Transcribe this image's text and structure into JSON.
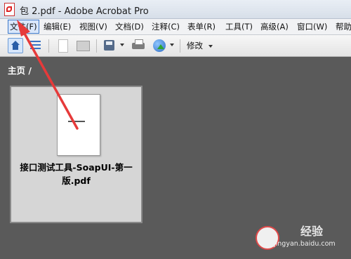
{
  "window": {
    "title": "包 2.pdf - Adobe Acrobat Pro"
  },
  "menu": [
    {
      "label": "文件(F)"
    },
    {
      "label": "编辑(E)"
    },
    {
      "label": "视图(V)"
    },
    {
      "label": "文档(D)"
    },
    {
      "label": "注释(C)"
    },
    {
      "label": "表单(R)"
    },
    {
      "label": "工具(T)"
    },
    {
      "label": "高级(A)"
    },
    {
      "label": "窗口(W)"
    },
    {
      "label": "帮助"
    }
  ],
  "toolbar": {
    "modify_label": "修改"
  },
  "breadcrumb": "主页 /",
  "files": [
    {
      "name": "接口测试工具-SoapUI-第一版.pdf"
    }
  ],
  "watermark": {
    "brand": "经验",
    "url": "jingyan.baidu.com"
  },
  "colors": {
    "annotation_arrow": "#e63a3a",
    "workspace": "#5a5a5a"
  }
}
